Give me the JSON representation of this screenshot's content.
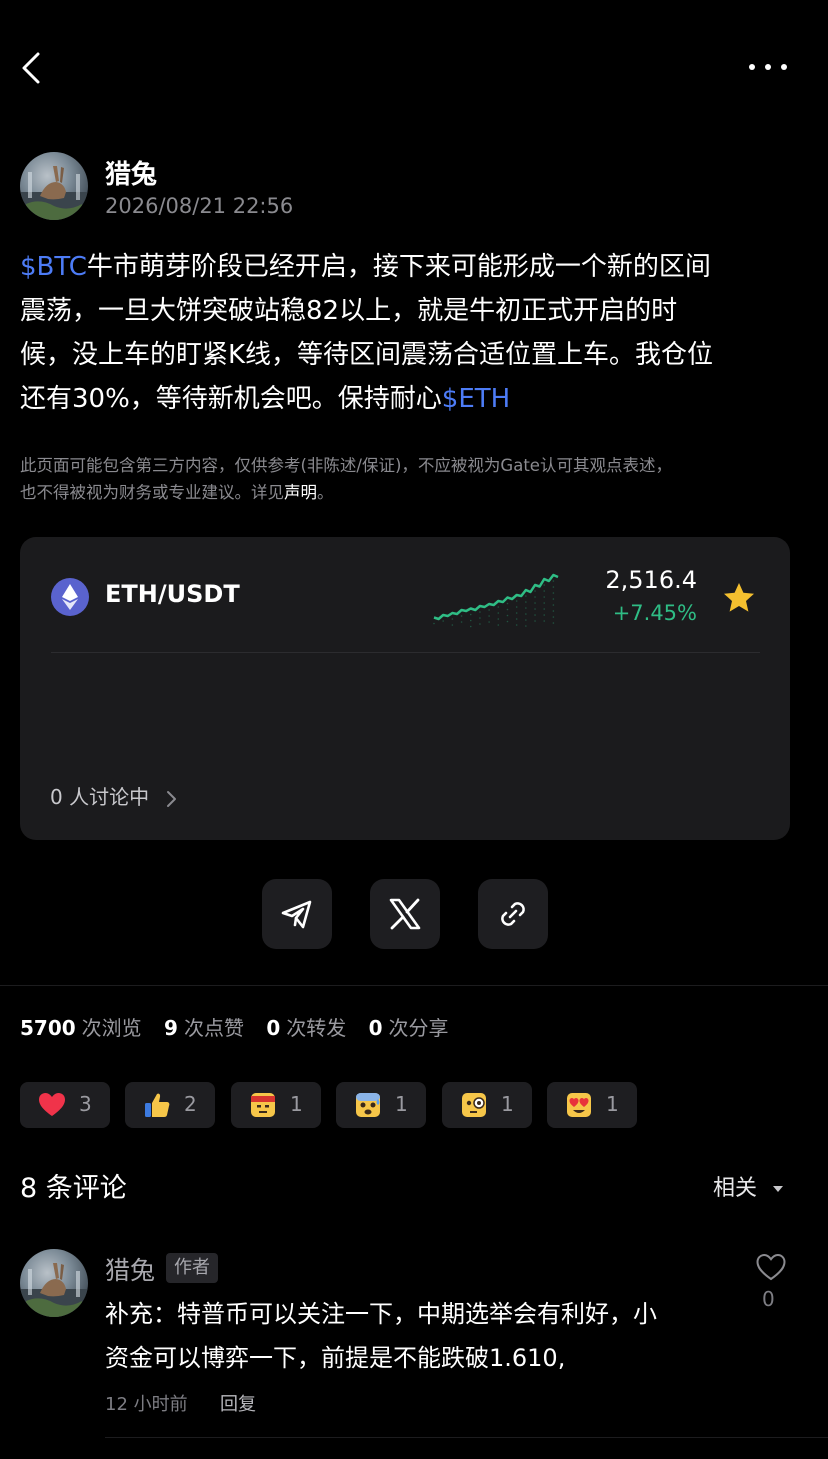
{
  "topbar": {
    "back_icon": "chevron-left-icon",
    "more_icon": "more-dots-icon"
  },
  "post": {
    "author": "猎兔",
    "timestamp": "2026/08/21 22:56",
    "content": {
      "line1_ticker": "$BTC",
      "line1_text": "牛市萌芽阶段已经开启，接下来可能形成一个新的区间",
      "line2": "震荡，一旦大饼突破站稳82以上，就是牛初正式开启的时",
      "line3": "候，没上车的盯紧K线，等待区间震荡合适位置上车。我仓位",
      "line4_text": "还有30%，等待新机会吧。保持耐心",
      "line4_ticker": "$ETH"
    },
    "disclaimer": {
      "line1": "此页面可能包含第三方内容，仅供参考(非陈述/保证)，不应被视为Gate认可其观点表述，",
      "line2_prefix": "也不得被视为财务或专业建议。详见",
      "link": "声明",
      "line2_suffix": "。"
    }
  },
  "market_card": {
    "pair": "ETH/USDT",
    "price": "2,516.4",
    "change": "+7.45%",
    "coin_icon": "ethereum-icon",
    "favorite_icon": "star-icon",
    "discussion": "0 人讨论中",
    "colors": {
      "up": "#2fbd85",
      "star": "#f5c02f",
      "coin": "#5a63ce"
    },
    "sparkline_trend": [
      0.15,
      0.12,
      0.2,
      0.18,
      0.24,
      0.22,
      0.3,
      0.28,
      0.33,
      0.3,
      0.38,
      0.36,
      0.42,
      0.4,
      0.48,
      0.46,
      0.55,
      0.52,
      0.6,
      0.58,
      0.7,
      0.66,
      0.8,
      0.77,
      0.92,
      0.88,
      1.0,
      0.96
    ]
  },
  "share": {
    "telegram_icon": "telegram-icon",
    "x_icon": "x-logo-icon",
    "link_icon": "link-icon"
  },
  "stats": [
    {
      "num": "5700",
      "label": "次浏览"
    },
    {
      "num": "9",
      "label": "次点赞"
    },
    {
      "num": "0",
      "label": "次转发"
    },
    {
      "num": "0",
      "label": "次分享"
    }
  ],
  "reactions": [
    {
      "icon": "heart-icon",
      "count": "3"
    },
    {
      "icon": "thumbs-up-icon",
      "count": "2"
    },
    {
      "icon": "bandana-face-icon",
      "count": "1"
    },
    {
      "icon": "anxious-face-icon",
      "count": "1"
    },
    {
      "icon": "monocle-face-icon",
      "count": "1"
    },
    {
      "icon": "heart-eyes-face-icon",
      "count": "1"
    }
  ],
  "comments_section": {
    "title": "8 条评论",
    "sort_label": "相关"
  },
  "comment": {
    "author": "猎兔",
    "badge": "作者",
    "line1": "补充：特普币可以关注一下，中期选举会有利好，小",
    "line2": "资金可以博弈一下，前提是不能跌破1.610,",
    "time": "12 小时前",
    "reply": "回复",
    "likes": "0"
  }
}
